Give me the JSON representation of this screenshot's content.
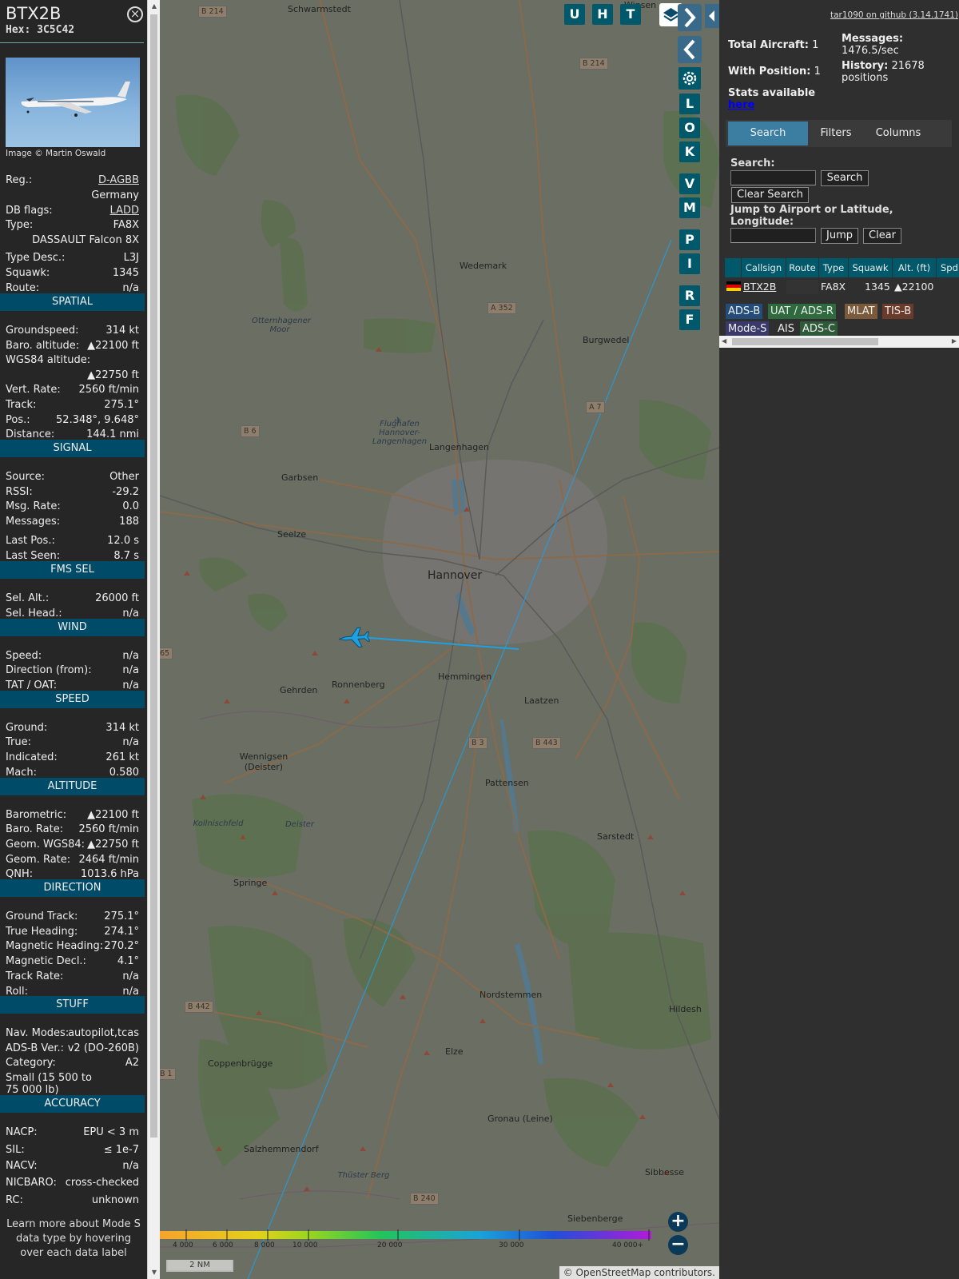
{
  "aircraft": {
    "callsign": "BTX2B",
    "hex": "Hex: 3C5C42",
    "image_credit": "Image © Martin Oswald",
    "basic": [
      {
        "k": "Reg.:",
        "v": "D-AGBB",
        "link": true
      },
      {
        "k": "",
        "v": "Germany"
      },
      {
        "k": "DB flags:",
        "v": "LADD",
        "link": true
      },
      {
        "k": "Type:",
        "v": "FA8X"
      },
      {
        "k": "",
        "v": "DASSAULT Falcon 8X"
      },
      {
        "k": "Type Desc.:",
        "v": "L3J"
      },
      {
        "k": "Squawk:",
        "v": "1345"
      },
      {
        "k": "Route:",
        "v": "n/a"
      }
    ],
    "sections": {
      "spatial": {
        "title": "SPATIAL",
        "rows": [
          {
            "k": "Groundspeed:",
            "v": "314 kt"
          },
          {
            "k": "Baro. altitude:",
            "v": "▲22100 ft"
          },
          {
            "k": "WGS84 altitude:",
            "v": ""
          },
          {
            "k": "",
            "v": "▲22750 ft"
          },
          {
            "k": "Vert. Rate:",
            "v": "2560 ft/min"
          },
          {
            "k": "Track:",
            "v": "275.1°"
          },
          {
            "k": "Pos.:",
            "v": "52.348°, 9.648°"
          },
          {
            "k": "Distance:",
            "v": "144.1 nmi"
          }
        ]
      },
      "signal": {
        "title": "SIGNAL",
        "rows": [
          {
            "k": "Source:",
            "v": "Other"
          },
          {
            "k": "RSSI:",
            "v": "-29.2"
          },
          {
            "k": "Msg. Rate:",
            "v": "0.0"
          },
          {
            "k": "Messages:",
            "v": "188"
          },
          {
            "k": "Last Pos.:",
            "v": "12.0 s"
          },
          {
            "k": "Last Seen:",
            "v": "8.7 s"
          }
        ]
      },
      "fms": {
        "title": "FMS SEL",
        "rows": [
          {
            "k": "Sel. Alt.:",
            "v": "26000 ft"
          },
          {
            "k": "Sel. Head.:",
            "v": "n/a"
          }
        ]
      },
      "wind": {
        "title": "WIND",
        "rows": [
          {
            "k": "Speed:",
            "v": "n/a"
          },
          {
            "k": "Direction (from):",
            "v": "n/a"
          },
          {
            "k": "TAT / OAT:",
            "v": "n/a"
          }
        ]
      },
      "speed": {
        "title": "SPEED",
        "rows": [
          {
            "k": "Ground:",
            "v": "314 kt"
          },
          {
            "k": "True:",
            "v": "n/a"
          },
          {
            "k": "Indicated:",
            "v": "261 kt"
          },
          {
            "k": "Mach:",
            "v": "0.580"
          }
        ]
      },
      "altitude": {
        "title": "ALTITUDE",
        "rows": [
          {
            "k": "Barometric:",
            "v": "▲22100 ft"
          },
          {
            "k": "Baro. Rate:",
            "v": "2560 ft/min"
          },
          {
            "k": "Geom. WGS84:",
            "v": "▲22750 ft"
          },
          {
            "k": "Geom. Rate:",
            "v": "2464 ft/min"
          },
          {
            "k": "QNH:",
            "v": "1013.6 hPa"
          }
        ]
      },
      "direction": {
        "title": "DIRECTION",
        "rows": [
          {
            "k": "Ground Track:",
            "v": "275.1°"
          },
          {
            "k": "True Heading:",
            "v": "274.1°"
          },
          {
            "k": "Magnetic Heading:",
            "v": "270.2°"
          },
          {
            "k": "Magnetic Decl.:",
            "v": "4.1°"
          },
          {
            "k": "Track Rate:",
            "v": "n/a"
          },
          {
            "k": "Roll:",
            "v": "n/a"
          }
        ]
      },
      "stuff": {
        "title": "STUFF",
        "rows": [
          {
            "k": "Nav. Modes:",
            "v": "autopilot,tcas"
          },
          {
            "k": "ADS-B Ver.:",
            "v": "v2 (DO-260B)"
          },
          {
            "k": "Category:",
            "v": "A2"
          },
          {
            "k": "Small (15 500 to",
            "v": ""
          },
          {
            "k": "75 000 lb)",
            "v": ""
          }
        ]
      },
      "accuracy": {
        "title": "ACCURACY",
        "rows": [
          {
            "k": "NACP:",
            "v": "EPU < 3 m"
          },
          {
            "k": "SIL:",
            "v": "≤ 1e-7"
          },
          {
            "k": "NACV:",
            "v": "n/a"
          },
          {
            "k": "NICBARO:",
            "v": "cross-checked"
          },
          {
            "k": "RC:",
            "v": "unknown"
          }
        ]
      }
    },
    "footer_note": "Learn more about Mode S data type by hovering over each data label"
  },
  "map": {
    "places": [
      "Schwarmstedt",
      "Wedemark",
      "Otternhagener Moor",
      "Burgwedel",
      "Flughafen Hannover-Langenhagen",
      "Langenhagen",
      "Garbsen",
      "Seelze",
      "Hannover",
      "Hemmingen",
      "Ronnenberg",
      "Gehrden",
      "Laatzen",
      "Wennigsen (Deister)",
      "Pattensen",
      "Deister",
      "Sarstedt",
      "Springe",
      "Nordstemmen",
      "Hildesh",
      "Coppenbrügge",
      "Elze",
      "Gronau (Leine)",
      "Salzhemmendorf",
      "Sibbesse",
      "Siebenberge",
      "Thüster Berg",
      "Kollnischfeld",
      "Winsen"
    ],
    "shields": [
      "B 214",
      "B 214",
      "A 352",
      "A 7",
      "B 6",
      "B 3",
      "B 443",
      "B 442",
      "B 1",
      "B 240",
      "65"
    ],
    "top_buttons": [
      "U",
      "H",
      "T"
    ],
    "side_buttons": [
      "L",
      "O",
      "K",
      "V",
      "M",
      "P",
      "I",
      "R",
      "F"
    ],
    "altitude_legend": [
      "4 000",
      "6 000",
      "8 000",
      "10 000",
      "20 000",
      "30 000",
      "40 000+"
    ],
    "scale": "2 NM",
    "attribution": "© OpenStreetMap contributors.",
    "zoom_in": "+",
    "zoom_out": "−"
  },
  "panel": {
    "github": "tar1090 on github (3.14.1741)",
    "total_aircraft_label": "Total Aircraft:",
    "total_aircraft": "1",
    "with_position_label": "With Position:",
    "with_position": "1",
    "messages_label": "Messages:",
    "messages": "1476.5/sec",
    "history_label": "History:",
    "history": "21678 positions",
    "stats_label": "Stats available",
    "stats_link": "here",
    "tabs": [
      "Search",
      "Filters",
      "Columns"
    ],
    "search_label": "Search:",
    "search_button": "Search",
    "clear_search_button": "Clear Search",
    "jump_label": "Jump to Airport or Latitude, Longitude:",
    "jump_button": "Jump",
    "clear_button": "Clear",
    "table_headers": [
      "Callsign",
      "Route",
      "Type",
      "Squawk",
      "Alt. (ft)",
      "Spd"
    ],
    "table_row": {
      "callsign": "BTX2B",
      "route": "",
      "type": "FA8X",
      "squawk": "1345",
      "alt": "▲22100"
    },
    "source_tags": [
      "ADS-B",
      "UAT / ADS-R",
      "MLAT",
      "TIS-B",
      "Mode-S",
      "AIS",
      "ADS-C"
    ]
  },
  "colors": {
    "accent": "#00596b",
    "section": "#004b68",
    "track": "#1da1e3",
    "tab_active": "#3b7ea1"
  }
}
